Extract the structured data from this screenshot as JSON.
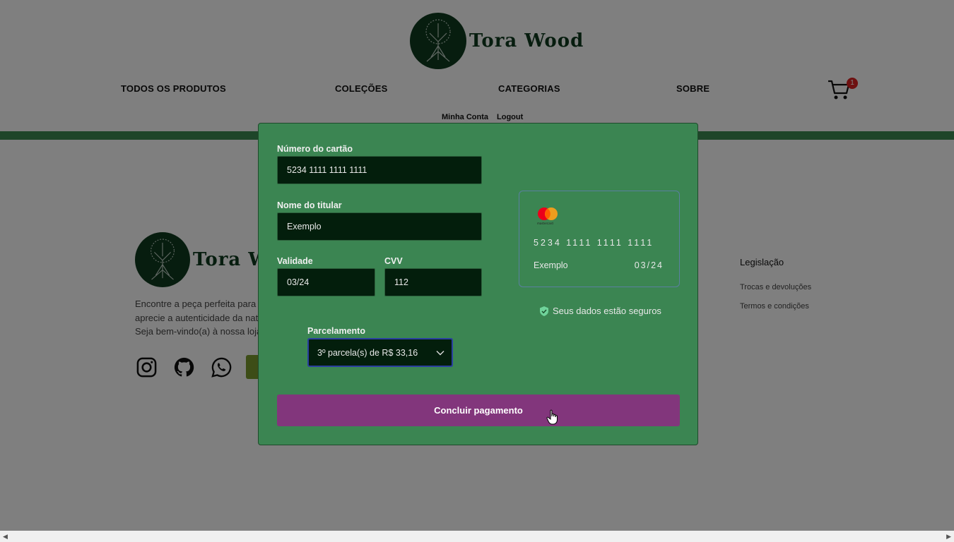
{
  "header": {
    "brand": "Tora Wood",
    "nav": [
      "TODOS OS PRODUTOS",
      "COLEÇÕES",
      "CATEGORIAS",
      "SOBRE"
    ],
    "cart_count": "1",
    "account_link": "Minha Conta",
    "logout_link": "Logout"
  },
  "footer": {
    "brand": "Tora Wood",
    "description": [
      "Encontre a peça perfeita para",
      "aprecie a autenticidade da nat",
      "Seja bem-vindo(a) à nossa loja"
    ],
    "legislation_title": "Legislação",
    "legislation_links": [
      "Trocas e devoluções",
      "Termos e condições"
    ]
  },
  "payment": {
    "card_number_label": "Número do cartão",
    "card_number_value": "5234 1111 1111 1111",
    "holder_label": "Nome do titular",
    "holder_value": "Exemplo",
    "expiry_label": "Validade",
    "expiry_value": "03/24",
    "cvv_label": "CVV",
    "cvv_value": "112",
    "installments_label": "Parcelamento",
    "installments_value": "3º parcela(s) de R$ 33,16",
    "card_preview": {
      "number": "5234 1111 1111 1111",
      "name": "Exemplo",
      "expiry": "03/24",
      "brand_caption": "mastercard"
    },
    "secure_text": "Seus dados estão seguros",
    "submit_label": "Concluir pagamento"
  },
  "colors": {
    "modal_bg": "#3b8552",
    "field_bg": "#031e0c",
    "submit_bg": "#82367c",
    "brand_green": "#0f3a1e"
  }
}
